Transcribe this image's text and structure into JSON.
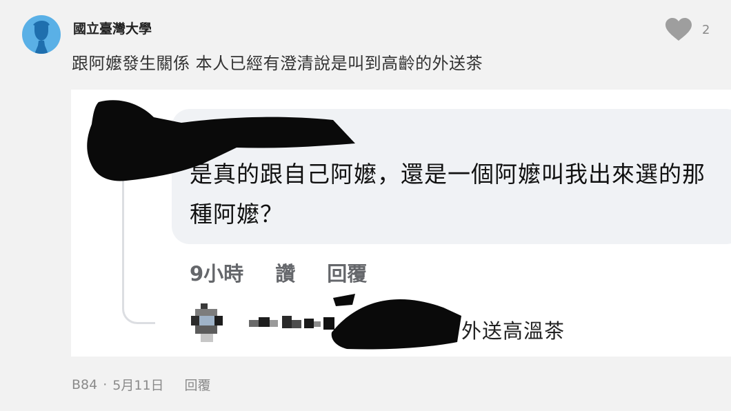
{
  "comment": {
    "author": "國立臺灣大學",
    "text": "跟阿嬤發生關係 本人已經有澄清說是叫到高齡的外送茶",
    "likes": "2",
    "floor": "B84",
    "date": "5月11日",
    "reply_label": "回覆"
  },
  "embedded_image": {
    "bubble_text": "是真的跟自己阿嬤，還是一個阿嬤叫我出來選的那種阿嬤？",
    "time": "9小時",
    "like_label": "讚",
    "reply_label": "回覆",
    "sub_reply_text": "外送高溫茶"
  },
  "colors": {
    "avatar_bg": "#5ab0e6",
    "bubble_bg": "#f0f2f5",
    "heart": "#9e9e9e",
    "meta_text": "#8a8a8a"
  },
  "icons": {
    "avatar": "person-silhouette-icon",
    "like": "heart-icon"
  }
}
